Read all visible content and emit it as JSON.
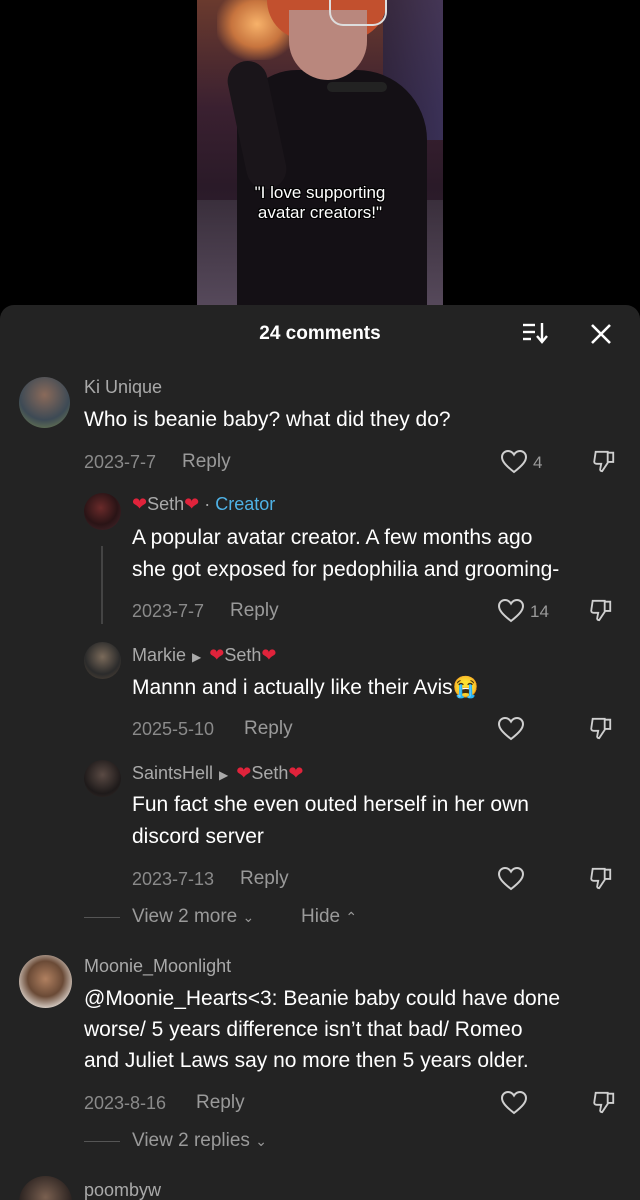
{
  "video": {
    "caption_line1": "\"I love supporting",
    "caption_line2": "avatar creators!\""
  },
  "sheet": {
    "title": "24 comments",
    "sort_icon": "sort-icon",
    "close_icon": "close-icon"
  },
  "comments": [
    {
      "username": "Ki Unique",
      "text": "Who is beanie baby? what did they do?",
      "date": "2023-7-7",
      "reply": "Reply",
      "likes": "4"
    },
    {
      "username": "Seth",
      "creator_label": "Creator",
      "text_line1": "A popular avatar creator. A few months ago",
      "text_line2": "she got exposed for pedophilia and grooming-",
      "date": "2023-7-7",
      "reply": "Reply",
      "likes": "14"
    },
    {
      "username": "Markie",
      "reply_to": "Seth",
      "text": "Mannn and i actually like their Avis",
      "emoji": "😭",
      "date": "2025-5-10",
      "reply": "Reply"
    },
    {
      "username": "SaintsHell",
      "reply_to": "Seth",
      "text_line1": "Fun fact she even outed herself in her own",
      "text_line2": "discord server",
      "date": "2023-7-13",
      "reply": "Reply"
    },
    {
      "username": "Moonie_Moonlight",
      "text_line1": "@Moonie_Hearts<3: Beanie baby could have done",
      "text_line2": "worse/ 5 years difference isn’t that bad/ Romeo",
      "text_line3": "and Juliet Laws say no more then 5 years older.",
      "date": "2023-8-16",
      "reply": "Reply"
    },
    {
      "username": "poombyw"
    }
  ],
  "thread_controls": {
    "view_more": "View 2 more",
    "hide": "Hide",
    "view_replies": "View 2 replies"
  },
  "colors": {
    "sheet_bg": "#232323",
    "creator_blue": "#4fb2e6",
    "heart_red": "#e0233b"
  }
}
